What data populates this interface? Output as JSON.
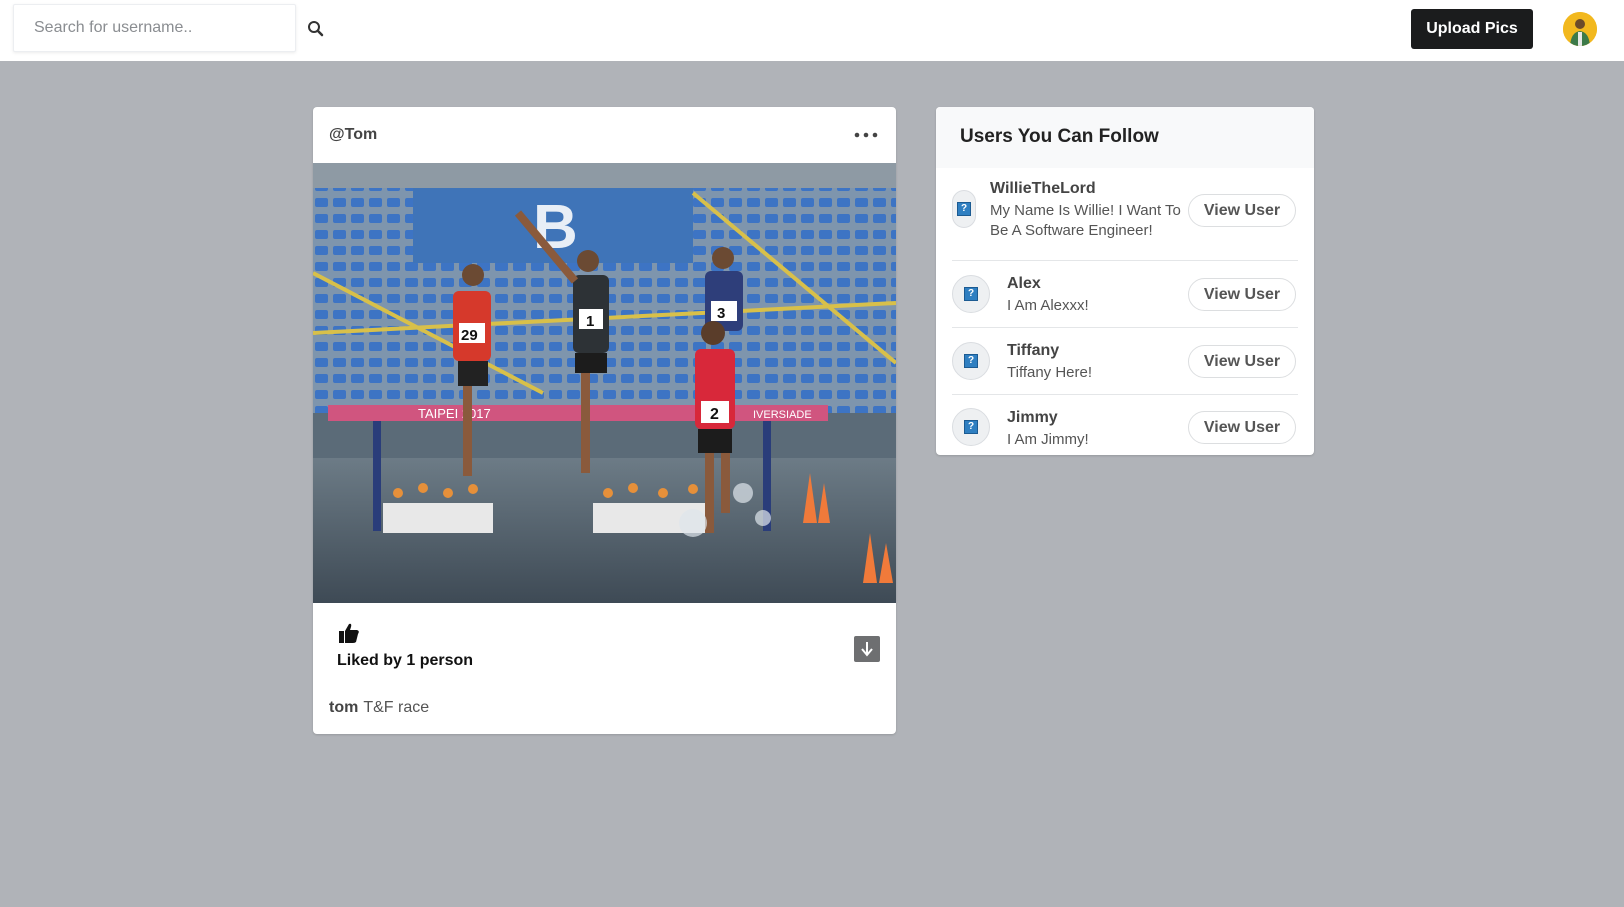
{
  "search": {
    "placeholder": "Search for username.."
  },
  "header": {
    "upload_label": "Upload Pics"
  },
  "post": {
    "username": "@Tom",
    "liked_text": "Liked by 1 person",
    "caption_user": "tom",
    "caption_text": "T&F race",
    "image_text": {
      "section_sign": "B",
      "banner": "TAIPEI 2017",
      "banner_right": "IVERSIADE",
      "bib_left": "29",
      "bib_center": "1",
      "bib_right": "3",
      "bib_front": "2"
    }
  },
  "follow": {
    "title": "Users You Can Follow",
    "button_label": "View User",
    "users": [
      {
        "name": "WillieTheLord",
        "bio_line1": "My Name Is Willie! I Want To",
        "bio_line2": "Be A Software Engineer!"
      },
      {
        "name": "Alex",
        "bio_line1": "I Am Alexxx!"
      },
      {
        "name": "Tiffany",
        "bio_line1": "Tiffany Here!"
      },
      {
        "name": "Jimmy",
        "bio_line1": "I Am Jimmy!"
      }
    ]
  },
  "colors": {
    "accent": "#1b1c1d",
    "background": "#b0b3b8"
  },
  "icons": [
    "search-icon",
    "more-icon",
    "thumbs-up-icon",
    "download-icon",
    "user-avatar-icon"
  ]
}
